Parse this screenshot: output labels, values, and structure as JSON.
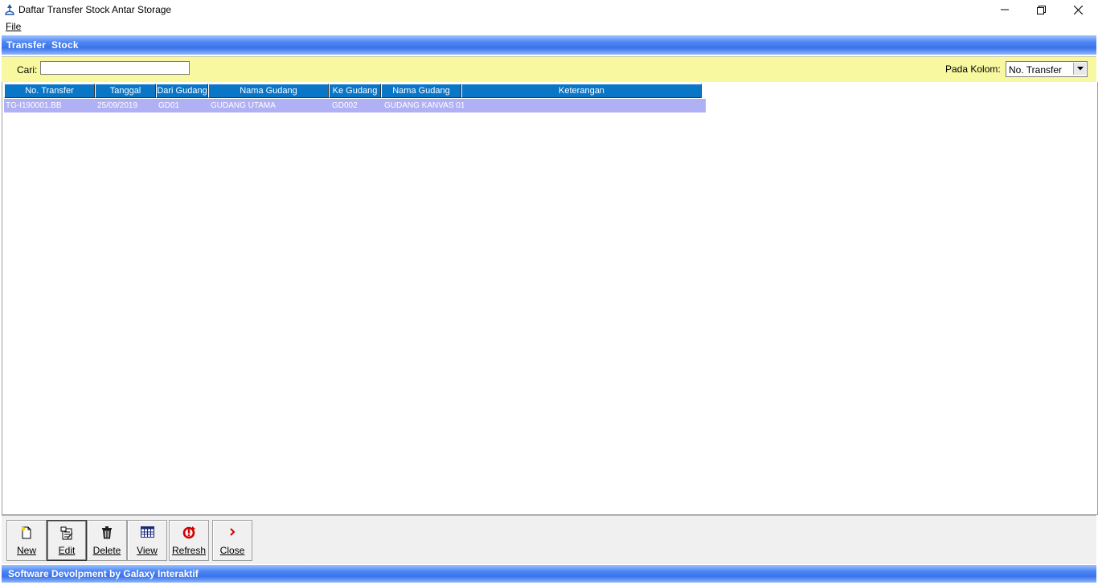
{
  "window": {
    "title": "Daftar Transfer Stock Antar Storage"
  },
  "menu": {
    "file_label": "File"
  },
  "header": {
    "title": "Transfer  Stock"
  },
  "search": {
    "label": "Cari:",
    "value": "",
    "column_label": "Pada Kolom:",
    "column_selected": "No. Transfer"
  },
  "grid": {
    "columns": [
      "No. Transfer",
      "Tanggal",
      "Dari Gudang",
      "Nama Gudang",
      "Ke Gudang",
      "Nama Gudang",
      "Keterangan"
    ],
    "rows": [
      [
        "TG-I190001.BB",
        "25/09/2019",
        "GD01",
        "GUDANG UTAMA",
        "GD002",
        "GUDANG KANVAS 01",
        ""
      ]
    ]
  },
  "toolbar": {
    "new_label": "New",
    "edit_label": "Edit",
    "delete_label": "Delete",
    "view_label": "View",
    "refresh_label": "Refresh",
    "close_label": "Close"
  },
  "footer": {
    "text": "Software Devolpment by Galaxy Interaktif"
  },
  "colors": {
    "header_band": "#3a72ea",
    "search_band": "#f8f8a0",
    "grid_header": "#0a76c8",
    "selected_row": "#b0b0f4"
  }
}
